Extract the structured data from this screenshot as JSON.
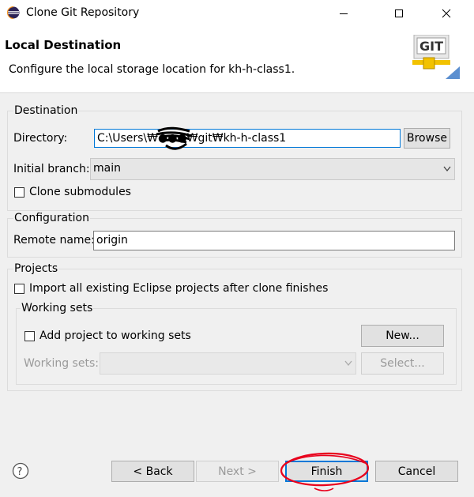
{
  "window": {
    "title": "Clone Git Repository",
    "minimize_icon": "minimize-icon",
    "maximize_icon": "maximize-icon",
    "close_icon": "close-icon"
  },
  "header": {
    "title": "Local Destination",
    "description": "Configure the local storage location for kh-h-class1.",
    "logo_text": "GIT"
  },
  "destination": {
    "label": "Destination",
    "directory_label": "Directory:",
    "directory_value": "C:\\Users\\₩●●●₩git₩kh-h-class1",
    "browse_label": "Browse",
    "branch_label": "Initial branch:",
    "branch_value": "main",
    "clone_submodules_label": "Clone submodules"
  },
  "configuration": {
    "label": "Configuration",
    "remote_label": "Remote name:",
    "remote_value": "origin"
  },
  "projects": {
    "label": "Projects",
    "import_label": "Import all existing Eclipse projects after clone finishes",
    "working_sets": {
      "label": "Working sets",
      "add_label": "Add project to working sets",
      "new_label": "New...",
      "sets_label": "Working sets:",
      "select_label": "Select..."
    }
  },
  "footer": {
    "back_label": "< Back",
    "next_label": "Next >",
    "finish_label": "Finish",
    "cancel_label": "Cancel"
  },
  "colors": {
    "accent": "#0078d7",
    "annotation": "#e8001c"
  }
}
